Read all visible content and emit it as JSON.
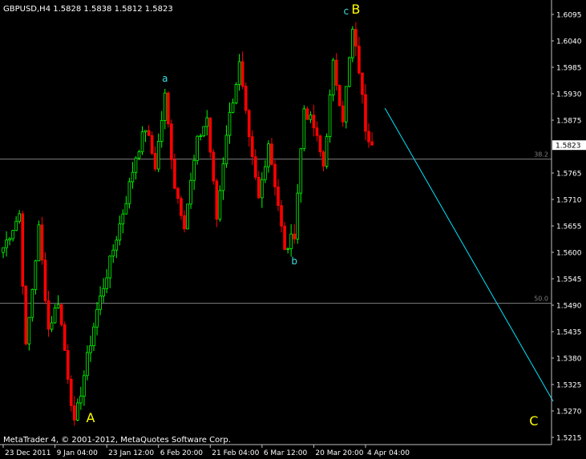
{
  "chart_data": {
    "type": "candlestick",
    "title": "GBPUSD,H4  1.5828 1.5838 1.5812 1.5823",
    "copyright": "MetaTrader 4, © 2001-2012, MetaQuotes Software Corp.",
    "ylim": [
      1.52,
      1.6115
    ],
    "y_ticks": [
      "1.6095",
      "1.6040",
      "1.5985",
      "1.5930",
      "1.5875",
      "1.5823",
      "1.5765",
      "1.5710",
      "1.5655",
      "1.5600",
      "1.5545",
      "1.5490",
      "1.5435",
      "1.5380",
      "1.5325",
      "1.5270",
      "1.5215"
    ],
    "x_ticks": [
      {
        "label": "23 Dec 2011",
        "x": 0
      },
      {
        "label": "9 Jan 04:00",
        "x": 16
      },
      {
        "label": "23 Jan 12:00",
        "x": 32
      },
      {
        "label": "6 Feb 20:00",
        "x": 48
      },
      {
        "label": "21 Feb 04:00",
        "x": 64
      },
      {
        "label": "6 Mar 12:00",
        "x": 80
      },
      {
        "label": "20 Mar 20:00",
        "x": 96
      },
      {
        "label": "4 Apr 04:00",
        "x": 112
      }
    ],
    "current_price": "1.5823",
    "fib_levels": [
      {
        "label": "38.2",
        "price": 1.5794
      },
      {
        "label": "50.0",
        "price": 1.5494
      }
    ],
    "trend_line": {
      "from": {
        "x": 118,
        "price": 1.59
      },
      "to": {
        "x": 170,
        "price": 1.529
      }
    },
    "waypoints": [
      {
        "x": 0,
        "price": 1.561
      },
      {
        "x": 5,
        "price": 1.568
      },
      {
        "x": 7,
        "price": 1.54
      },
      {
        "x": 11,
        "price": 1.565
      },
      {
        "x": 14,
        "price": 1.544
      },
      {
        "x": 17,
        "price": 1.55
      },
      {
        "x": 22,
        "price": 1.524
      },
      {
        "x": 26,
        "price": 1.538
      },
      {
        "x": 29,
        "price": 1.548
      },
      {
        "x": 33,
        "price": 1.558
      },
      {
        "x": 38,
        "price": 1.571
      },
      {
        "x": 41,
        "price": 1.58
      },
      {
        "x": 44,
        "price": 1.586
      },
      {
        "x": 47,
        "price": 1.578
      },
      {
        "x": 50,
        "price": 1.5925
      },
      {
        "x": 53,
        "price": 1.574
      },
      {
        "x": 56,
        "price": 1.566
      },
      {
        "x": 60,
        "price": 1.583
      },
      {
        "x": 63,
        "price": 1.588
      },
      {
        "x": 66,
        "price": 1.567
      },
      {
        "x": 69,
        "price": 1.585
      },
      {
        "x": 73,
        "price": 1.599
      },
      {
        "x": 76,
        "price": 1.583
      },
      {
        "x": 79,
        "price": 1.571
      },
      {
        "x": 82,
        "price": 1.583
      },
      {
        "x": 85,
        "price": 1.57
      },
      {
        "x": 87,
        "price": 1.56
      },
      {
        "x": 90,
        "price": 1.564
      },
      {
        "x": 93,
        "price": 1.59
      },
      {
        "x": 96,
        "price": 1.586
      },
      {
        "x": 99,
        "price": 1.578
      },
      {
        "x": 102,
        "price": 1.599
      },
      {
        "x": 105,
        "price": 1.588
      },
      {
        "x": 108,
        "price": 1.606
      },
      {
        "x": 110,
        "price": 1.598
      },
      {
        "x": 112,
        "price": 1.586
      },
      {
        "x": 114,
        "price": 1.5823
      }
    ],
    "wave_labels": [
      {
        "text": "A",
        "x": 27,
        "price": 1.5247,
        "color": "#ffff00",
        "size": 16
      },
      {
        "text": "a",
        "x": 50,
        "price": 1.5955,
        "color": "#3fe0e0",
        "size": 12
      },
      {
        "text": "b",
        "x": 90,
        "price": 1.5575,
        "color": "#3fe0e0",
        "size": 12
      },
      {
        "text": "c",
        "x": 106,
        "price": 1.6095,
        "color": "#3fe0e0",
        "size": 12
      },
      {
        "text": "B",
        "x": 109,
        "price": 1.6097,
        "color": "#ffff00",
        "size": 16
      },
      {
        "text": "C",
        "x": 164,
        "price": 1.524,
        "color": "#ffff00",
        "size": 16
      }
    ],
    "colors": {
      "background": "#000000",
      "bull": "#00ff00",
      "bear": "#ff0000",
      "axis": "#c0c0c0",
      "text": "#ffffff",
      "fib": "#808080",
      "trend": "#00e5ff"
    }
  }
}
